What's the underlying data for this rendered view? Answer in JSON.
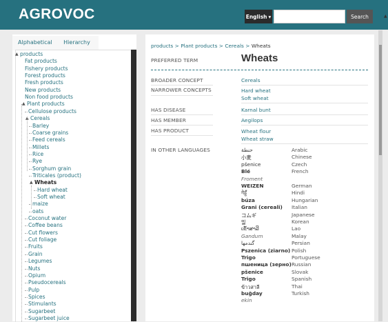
{
  "header": {
    "logo": "AGROVOC",
    "language": "English",
    "search_placeholder": "",
    "search_button": "Search"
  },
  "sidebar": {
    "tabs": [
      "Alphabetical",
      "Hierarchy"
    ],
    "tree": [
      {
        "label": "products",
        "expanded": true
      },
      {
        "label": "Fat products"
      },
      {
        "label": "Fishery products"
      },
      {
        "label": "Forest products"
      },
      {
        "label": "Fresh products"
      },
      {
        "label": "New products"
      },
      {
        "label": "Non food products"
      },
      {
        "label": "Plant products",
        "expanded": true
      },
      {
        "label": "Cellulose products"
      },
      {
        "label": "Cereals",
        "expanded": true
      },
      {
        "label": "Barley"
      },
      {
        "label": "Coarse grains"
      },
      {
        "label": "Feed cereals"
      },
      {
        "label": "Millets"
      },
      {
        "label": "Rice"
      },
      {
        "label": "Rye"
      },
      {
        "label": "Sorghum grain"
      },
      {
        "label": "Triticales (product)"
      },
      {
        "label": "Wheats",
        "expanded": true,
        "selected": true
      },
      {
        "label": "Hard wheat"
      },
      {
        "label": "Soft wheat"
      },
      {
        "label": "maize"
      },
      {
        "label": "oats"
      },
      {
        "label": "Coconut water"
      },
      {
        "label": "Coffee beans"
      },
      {
        "label": "Cut flowers"
      },
      {
        "label": "Cut foliage"
      },
      {
        "label": "Fruits"
      },
      {
        "label": "Grain"
      },
      {
        "label": "Legumes"
      },
      {
        "label": "Nuts"
      },
      {
        "label": "Opium"
      },
      {
        "label": "Pseudocereals"
      },
      {
        "label": "Pulp"
      },
      {
        "label": "Spices"
      },
      {
        "label": "Stimulants"
      },
      {
        "label": "Sugarbeet"
      },
      {
        "label": "Sugarbeet juice"
      }
    ]
  },
  "main": {
    "breadcrumb": [
      "products",
      "Plant products",
      "Cereals",
      "Wheats"
    ],
    "preferred_term_label": "PREFERRED TERM",
    "preferred_term": "Wheats",
    "broader_label": "BROADER CONCEPT",
    "broader": [
      "Cereals"
    ],
    "narrower_label": "NARROWER CONCEPTS",
    "narrower": [
      "Hard wheat",
      "Soft wheat"
    ],
    "disease_label": "HAS DISEASE",
    "disease": [
      "Karnal bunt"
    ],
    "member_label": "HAS MEMBER",
    "member": [
      "Aegilops"
    ],
    "product_label": "HAS PRODUCT",
    "product": [
      "Wheat flour",
      "Wheat straw"
    ],
    "languages_label": "IN OTHER LANGUAGES",
    "languages": [
      {
        "term": "حنطة",
        "lang": "Arabic"
      },
      {
        "term": "小麦",
        "lang": "Chinese"
      },
      {
        "term": "pšenice",
        "lang": "Czech"
      },
      {
        "term": "Blé",
        "lang": "French",
        "bold": true
      },
      {
        "term": "Froment",
        "lang": "",
        "italic": true
      },
      {
        "term": "WEIZEN",
        "lang": "German",
        "bold": true
      },
      {
        "term": "गेहूँ",
        "lang": "Hindi"
      },
      {
        "term": "búza",
        "lang": "Hungarian",
        "bold": true
      },
      {
        "term": "Grani (cereali)",
        "lang": "Italian",
        "bold": true
      },
      {
        "term": "コムギ",
        "lang": "Japanese"
      },
      {
        "term": "밀",
        "lang": "Korean"
      },
      {
        "term": "ເຂົ້າສາລີ",
        "lang": "Lao"
      },
      {
        "term": "Gandum",
        "lang": "Malay",
        "italic": true
      },
      {
        "term": "گندمها",
        "lang": "Persian"
      },
      {
        "term": "Pszenica (ziarno)",
        "lang": "Polish",
        "bold": true
      },
      {
        "term": "Trigo",
        "lang": "Portuguese",
        "bold": true
      },
      {
        "term": "пшеница (зерно)",
        "lang": "Russian",
        "bold": true
      },
      {
        "term": "pšenice",
        "lang": "Slovak",
        "bold": true
      },
      {
        "term": "Trigo",
        "lang": "Spanish",
        "bold": true
      },
      {
        "term": "ข้าวสาลี",
        "lang": "Thai"
      },
      {
        "term": "buğday",
        "lang": "Turkish",
        "bold": true
      },
      {
        "term": "ekin",
        "lang": "",
        "italic": true
      }
    ]
  }
}
